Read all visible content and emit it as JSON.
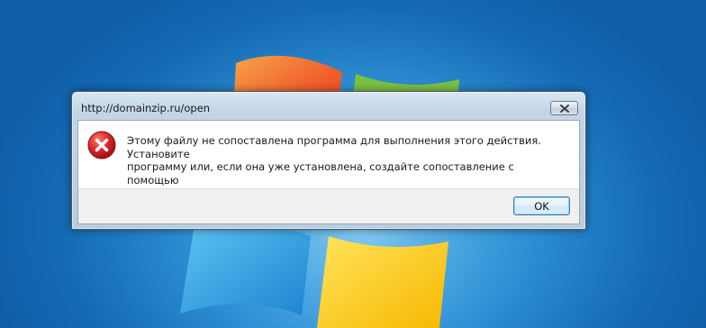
{
  "dialog": {
    "title": "http://domainzip.ru/open",
    "message": "Этому файлу не сопоставлена программа для выполнения этого действия. Установите\nпрограмму или, если она уже установлена, создайте сопоставление с помощью\nкомпонента панели управления \"Программы по умолчанию\".",
    "ok_label": "OK",
    "icon": "error-icon",
    "close_icon": "close-icon"
  },
  "colors": {
    "desktop_blue": "#1d7fc6",
    "error_red": "#d9272d",
    "ok_border": "#3c7fb1"
  }
}
